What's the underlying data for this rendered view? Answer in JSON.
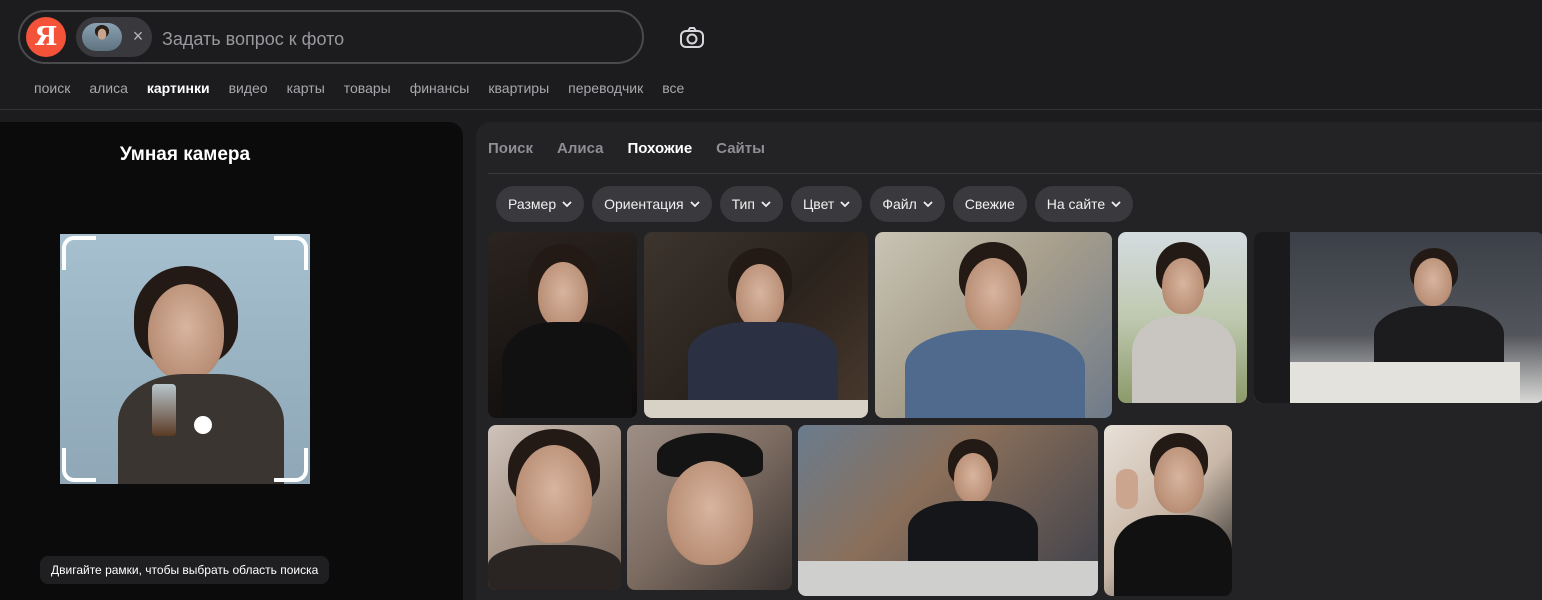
{
  "search": {
    "logo": "Я",
    "placeholder": "Задать вопрос к фото",
    "value": ""
  },
  "services": [
    "поиск",
    "алиса",
    "картинки",
    "видео",
    "карты",
    "товары",
    "финансы",
    "квартиры",
    "переводчик",
    "все"
  ],
  "active_service": "картинки",
  "smart_camera": {
    "title": "Умная камера",
    "hint": "Двигайте рамки, чтобы выбрать область поиска"
  },
  "sub_tabs": [
    "Поиск",
    "Алиса",
    "Похожие",
    "Сайты"
  ],
  "active_sub_tab": "Похожие",
  "filters": [
    "Размер",
    "Ориентация",
    "Тип",
    "Цвет",
    "Файл",
    "Свежие",
    "На сайте"
  ],
  "filters_with_dropdown": [
    "Размер",
    "Ориентация",
    "Тип",
    "Цвет",
    "Файл",
    "На сайте"
  ],
  "icons": {
    "chip_close": "close-icon",
    "camera": "camera-icon",
    "chevron": "chevron-down-icon"
  },
  "colors": {
    "logo_bg": "#f4533a",
    "background": "#1c1c1e",
    "panel": "#232326",
    "chip": "#3a3a3e"
  },
  "results_row1_count": 5,
  "results_row2_count": 4
}
